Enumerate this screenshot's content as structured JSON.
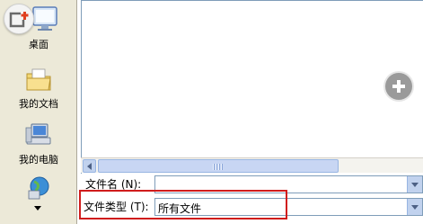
{
  "places": [
    {
      "label": "桌面",
      "icon": "desktop-icon"
    },
    {
      "label": "我的文档",
      "icon": "my-documents-icon"
    },
    {
      "label": "我的电脑",
      "icon": "my-computer-icon"
    },
    {
      "label": "",
      "icon": "network-places-icon"
    }
  ],
  "overlay": {
    "add_icon": "add-file-icon",
    "center_icon": "plus-circle-icon"
  },
  "form": {
    "filename_label": "文件名 (N):",
    "filename_value": "",
    "filetype_label": "文件类型 (T):",
    "filetype_value": "所有文件"
  },
  "colors": {
    "highlight": "#d01c1c",
    "dialog_bg": "#ece9d8",
    "scroll_accent": "#c1d2ee"
  }
}
